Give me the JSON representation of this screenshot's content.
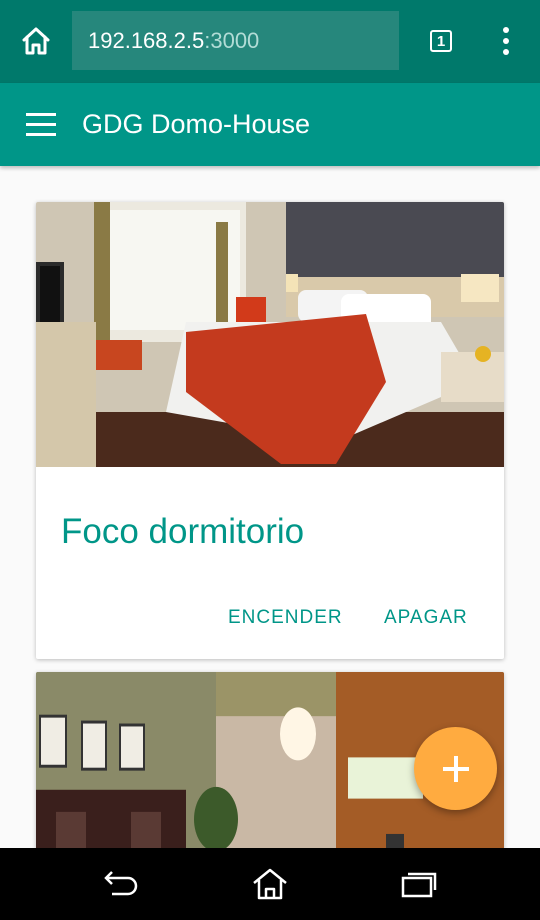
{
  "browser": {
    "url_host": "192.168.2.5",
    "url_port": ":3000",
    "tab_count": "1"
  },
  "app_bar": {
    "title": "GDG Domo-House"
  },
  "cards": [
    {
      "title": "Foco dormitorio",
      "image": "bedroom-photo",
      "actions": [
        "ENCENDER",
        "APAGAR"
      ]
    },
    {
      "image": "dining-room-photo"
    }
  ],
  "fab": {
    "icon": "plus-icon"
  },
  "colors": {
    "primary": "#009688",
    "primary_dark": "#00796b",
    "accent": "#ffab40"
  },
  "icons": {
    "browser": [
      "home-icon",
      "tabs-icon",
      "overflow-menu-icon"
    ],
    "app_bar": [
      "hamburger-menu-icon"
    ],
    "system_nav": [
      "back-icon",
      "home-icon",
      "recent-apps-icon"
    ]
  }
}
